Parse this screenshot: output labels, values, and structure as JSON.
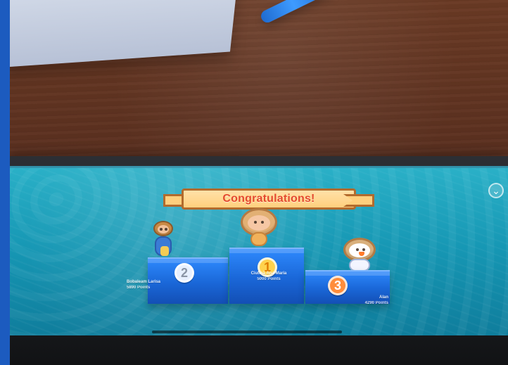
{
  "screen": {
    "banner": {
      "title": "Congratulations!"
    },
    "podium": [
      {
        "rank": "1",
        "name": "Ciutinã Ana-Maria",
        "points": "5000 Points"
      },
      {
        "rank": "2",
        "name": "Bobaleam Larisa",
        "points": "5890 Points"
      },
      {
        "rank": "3",
        "name": "Alan",
        "points": "4290 Points"
      }
    ],
    "controls": {
      "collapse_icon": "chevron-down-icon",
      "collapse_glyph": "⌄"
    }
  },
  "colors": {
    "frame_blue": "#1c5bbf",
    "screen_teal": "#1697b4",
    "banner_text": "#e44a2e",
    "podium_blue": "#1a67d8"
  }
}
